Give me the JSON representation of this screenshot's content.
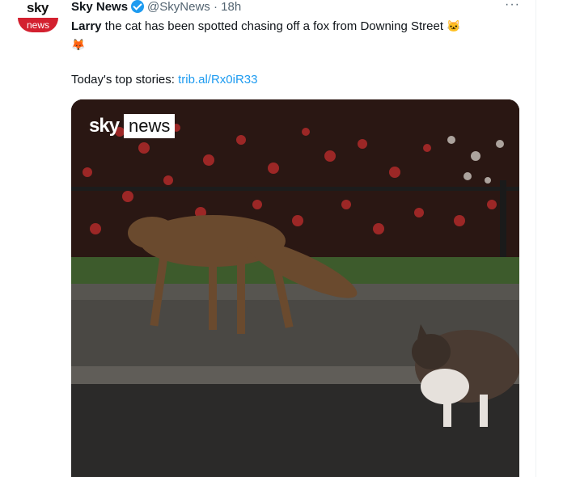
{
  "account": {
    "avatar_top": "sky",
    "avatar_bottom": "news",
    "name": "Sky News",
    "handle": "@SkyNews",
    "separator": "·",
    "time": "18h",
    "more": "···"
  },
  "tweet": {
    "bold_name": "Larry",
    "text": " the cat has been spotted chasing off a fox from Downing Street ",
    "emoji1": "🐱",
    "emoji2": "🦊",
    "stories_label": "Today's top stories: ",
    "link": "trib.al/Rx0iR33"
  },
  "media": {
    "logo_sky": "sky",
    "logo_news": "news"
  }
}
